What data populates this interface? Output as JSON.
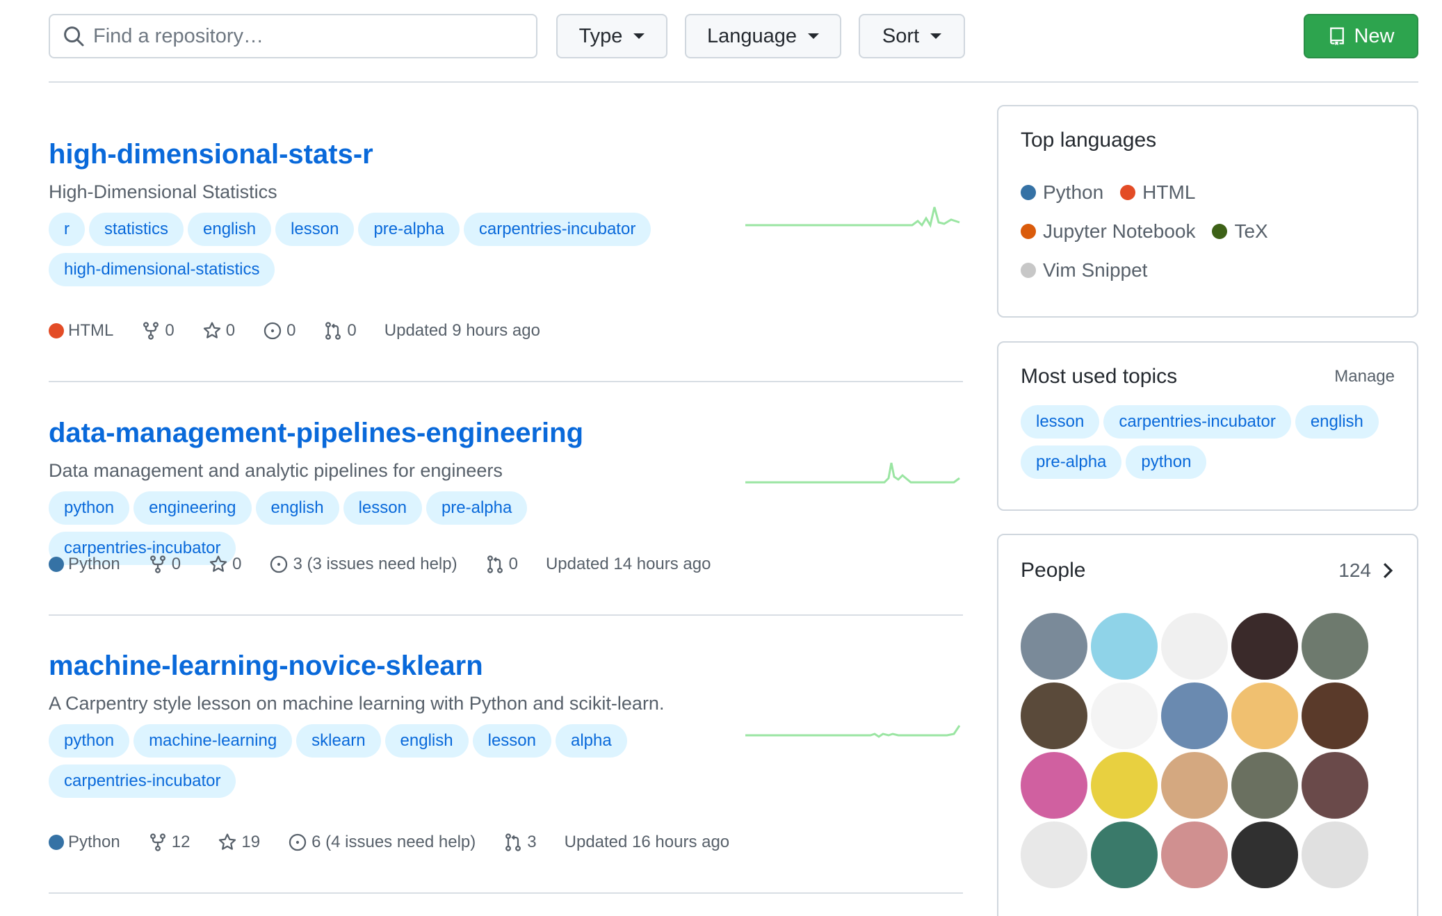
{
  "toolbar": {
    "search_placeholder": "Find a repository…",
    "type_label": "Type",
    "language_label": "Language",
    "sort_label": "Sort",
    "new_label": "New"
  },
  "repos": [
    {
      "name": "high-dimensional-stats-r",
      "description": "High-Dimensional Statistics",
      "topics": [
        "r",
        "statistics",
        "english",
        "lesson",
        "pre-alpha",
        "carpentries-incubator",
        "high-dimensional-statistics"
      ],
      "language": "HTML",
      "language_color": "#e34c26",
      "forks": "0",
      "stars": "0",
      "issues": "0",
      "pulls": "0",
      "updated": "Updated 9 hours ago"
    },
    {
      "name": "data-management-pipelines-engineering",
      "description": "Data management and analytic pipelines for engineers",
      "topics": [
        "python",
        "engineering",
        "english",
        "lesson",
        "pre-alpha",
        "carpentries-incubator"
      ],
      "language": "Python",
      "language_color": "#3572A5",
      "forks": "0",
      "stars": "0",
      "issues": "3 (3 issues need help)",
      "pulls": "0",
      "updated": "Updated 14 hours ago"
    },
    {
      "name": "machine-learning-novice-sklearn",
      "description": "A Carpentry style lesson on machine learning with Python and scikit-learn.",
      "topics": [
        "python",
        "machine-learning",
        "sklearn",
        "english",
        "lesson",
        "alpha",
        "carpentries-incubator"
      ],
      "language": "Python",
      "language_color": "#3572A5",
      "forks": "12",
      "stars": "19",
      "issues": "6 (4 issues need help)",
      "pulls": "3",
      "updated": "Updated 16 hours ago"
    }
  ],
  "top_languages": {
    "title": "Top languages",
    "items": [
      {
        "name": "Python",
        "color": "#3572A5"
      },
      {
        "name": "HTML",
        "color": "#e34c26"
      },
      {
        "name": "Jupyter Notebook",
        "color": "#DA5B0B"
      },
      {
        "name": "TeX",
        "color": "#3D6117"
      },
      {
        "name": "Vim Snippet",
        "color": "#c7c7c7"
      }
    ]
  },
  "topics_box": {
    "title": "Most used topics",
    "manage_label": "Manage",
    "items": [
      "lesson",
      "carpentries-incubator",
      "english",
      "pre-alpha",
      "python"
    ]
  },
  "people": {
    "title": "People",
    "count": "124",
    "avatar_colors": [
      "#7a8a99",
      "#8fd3e8",
      "#f0f0f0",
      "#3a2a2a",
      "#6e7a6e",
      "#5a4a3a",
      "#f4f4f4",
      "#6a8ab0",
      "#f0c070",
      "#5a3a2a",
      "#d060a0",
      "#e8d040",
      "#d4a880",
      "#6a7060",
      "#6a4a4a",
      "#e8e8e8",
      "#3a7a6a",
      "#d09090",
      "#303030",
      "#e0e0e0"
    ]
  }
}
